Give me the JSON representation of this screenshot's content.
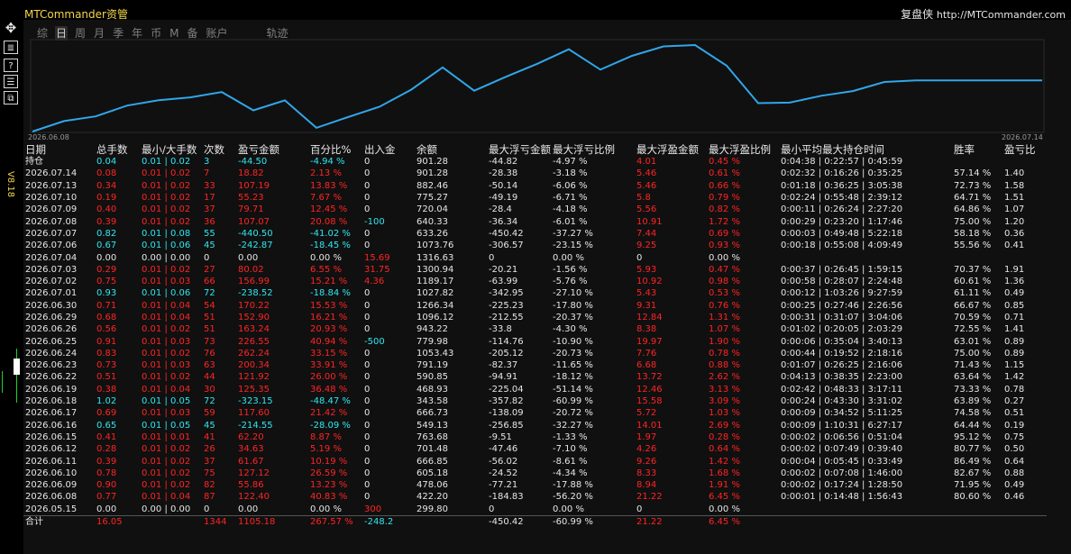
{
  "app": {
    "title": "MTCommander资管",
    "right_label": "复盘侠",
    "right_url": "http://MTCommander.com",
    "version": "V8.18"
  },
  "tabs": [
    "综",
    "日",
    "周",
    "月",
    "季",
    "年",
    "币",
    "M",
    "备",
    "账户",
    "轨迹"
  ],
  "active_tab": "日",
  "sidebar_buttons": [
    "move-icon",
    "list-icon",
    "help-icon",
    "settings-icon",
    "window-icon"
  ],
  "chart": {
    "start_date": "2026.06.08",
    "end_date": "2026.07.14",
    "line_color": "#31a6e8",
    "balance_series": [
      299.8,
      422.2,
      478.06,
      605.18,
      666.85,
      701.48,
      763.68,
      549.13,
      666.73,
      343.58,
      468.93,
      590.85,
      791.19,
      1053.43,
      779.98,
      943.22,
      1096.12,
      1266.34,
      1027.82,
      1189.17,
      1300.94,
      1316.63,
      1073.76,
      633.26,
      640.33,
      720.04,
      775.27,
      882.46,
      901.28,
      901.28,
      901.28,
      901.28,
      901.28
    ]
  },
  "table": {
    "headers": [
      "日期",
      "总手数",
      "最小/大手数",
      "次数",
      "盈亏金额",
      "百分比%",
      "出入金",
      "余额",
      "最大浮亏金额",
      "最大浮亏比例",
      "最大浮盈金额",
      "最大浮盈比例",
      "最小平均最大持仓时间",
      "胜率",
      "盈亏比"
    ],
    "rows": [
      {
        "date": "持仓",
        "lots": "0.04",
        "minmax": "0.01 | 0.02",
        "count": "3",
        "pl": "-44.50",
        "pct": "-4.94 %",
        "dep": "0",
        "bal": "901.28",
        "mdd": "-44.82",
        "mddp": "-4.97 %",
        "mfe": "4.01",
        "mfep": "0.45 %",
        "hold": "0:04:38 | 0:22:57 | 0:45:59",
        "win": "",
        "pf": ""
      },
      {
        "date": "2026.07.14",
        "lots": "0.08",
        "minmax": "0.01 | 0.02",
        "count": "7",
        "pl": "18.82",
        "pct": "2.13 %",
        "dep": "0",
        "bal": "901.28",
        "mdd": "-28.38",
        "mddp": "-3.18 %",
        "mfe": "5.46",
        "mfep": "0.61 %",
        "hold": "0:02:32 | 0:16:26 | 0:35:25",
        "win": "57.14 %",
        "pf": "1.40"
      },
      {
        "date": "2026.07.13",
        "lots": "0.34",
        "minmax": "0.01 | 0.02",
        "count": "33",
        "pl": "107.19",
        "pct": "13.83 %",
        "dep": "0",
        "bal": "882.46",
        "mdd": "-50.14",
        "mddp": "-6.06 %",
        "mfe": "5.46",
        "mfep": "0.66 %",
        "hold": "0:01:18 | 0:36:25 | 3:05:38",
        "win": "72.73 %",
        "pf": "1.58"
      },
      {
        "date": "2026.07.10",
        "lots": "0.19",
        "minmax": "0.01 | 0.02",
        "count": "17",
        "pl": "55.23",
        "pct": "7.67 %",
        "dep": "0",
        "bal": "775.27",
        "mdd": "-49.19",
        "mddp": "-6.71 %",
        "mfe": "5.8",
        "mfep": "0.79 %",
        "hold": "0:02:24 | 0:55:48 | 2:39:12",
        "win": "64.71 %",
        "pf": "1.51"
      },
      {
        "date": "2026.07.09",
        "lots": "0.40",
        "minmax": "0.01 | 0.02",
        "count": "37",
        "pl": "79.71",
        "pct": "12.45 %",
        "dep": "0",
        "bal": "720.04",
        "mdd": "-28.4",
        "mddp": "-4.18 %",
        "mfe": "5.56",
        "mfep": "0.82 %",
        "hold": "0:00:11 | 0:26:24 | 2:27:20",
        "win": "64.86 %",
        "pf": "1.07"
      },
      {
        "date": "2026.07.08",
        "lots": "0.39",
        "minmax": "0.01 | 0.02",
        "count": "36",
        "pl": "107.07",
        "pct": "20.08 %",
        "dep": "-100",
        "bal": "640.33",
        "mdd": "-36.34",
        "mddp": "-6.01 %",
        "mfe": "10.91",
        "mfep": "1.72 %",
        "hold": "0:00:29 | 0:23:20 | 1:17:46",
        "win": "75.00 %",
        "pf": "1.20"
      },
      {
        "date": "2026.07.07",
        "lots": "0.82",
        "minmax": "0.01 | 0.08",
        "count": "55",
        "pl": "-440.50",
        "pct": "-41.02 %",
        "dep": "0",
        "bal": "633.26",
        "mdd": "-450.42",
        "mddp": "-37.27 %",
        "mfe": "7.44",
        "mfep": "0.69 %",
        "hold": "0:00:03 | 0:49:48 | 5:22:18",
        "win": "58.18 %",
        "pf": "0.36"
      },
      {
        "date": "2026.07.06",
        "lots": "0.67",
        "minmax": "0.01 | 0.06",
        "count": "45",
        "pl": "-242.87",
        "pct": "-18.45 %",
        "dep": "0",
        "bal": "1073.76",
        "mdd": "-306.57",
        "mddp": "-23.15 %",
        "mfe": "9.25",
        "mfep": "0.93 %",
        "hold": "0:00:18 | 0:55:08 | 4:09:49",
        "win": "55.56 %",
        "pf": "0.41"
      },
      {
        "date": "2026.07.04",
        "lots": "0.00",
        "minmax": "0.00 | 0.00",
        "count": "0",
        "pl": "0.00",
        "pct": "0.00 %",
        "dep": "15.69",
        "bal": "1316.63",
        "mdd": "0",
        "mddp": "0.00 %",
        "mfe": "0",
        "mfep": "0.00 %",
        "hold": "",
        "win": "",
        "pf": ""
      },
      {
        "date": "2026.07.03",
        "lots": "0.29",
        "minmax": "0.01 | 0.02",
        "count": "27",
        "pl": "80.02",
        "pct": "6.55 %",
        "dep": "31.75",
        "bal": "1300.94",
        "mdd": "-20.21",
        "mddp": "-1.56 %",
        "mfe": "5.93",
        "mfep": "0.47 %",
        "hold": "0:00:37 | 0:26:45 | 1:59:15",
        "win": "70.37 %",
        "pf": "1.91"
      },
      {
        "date": "2026.07.02",
        "lots": "0.75",
        "minmax": "0.01 | 0.03",
        "count": "66",
        "pl": "156.99",
        "pct": "15.21 %",
        "dep": "4.36",
        "bal": "1189.17",
        "mdd": "-63.99",
        "mddp": "-5.76 %",
        "mfe": "10.92",
        "mfep": "0.98 %",
        "hold": "0:00:58 | 0:28:07 | 2:24:48",
        "win": "60.61 %",
        "pf": "1.36"
      },
      {
        "date": "2026.07.01",
        "lots": "0.93",
        "minmax": "0.01 | 0.06",
        "count": "72",
        "pl": "-238.52",
        "pct": "-18.84 %",
        "dep": "0",
        "bal": "1027.82",
        "mdd": "-342.95",
        "mddp": "-27.10 %",
        "mfe": "5.43",
        "mfep": "0.53 %",
        "hold": "0:00:12 | 1:03:26 | 9:27:59",
        "win": "61.11 %",
        "pf": "0.49"
      },
      {
        "date": "2026.06.30",
        "lots": "0.71",
        "minmax": "0.01 | 0.04",
        "count": "54",
        "pl": "170.22",
        "pct": "15.53 %",
        "dep": "0",
        "bal": "1266.34",
        "mdd": "-225.23",
        "mddp": "-17.80 %",
        "mfe": "9.31",
        "mfep": "0.76 %",
        "hold": "0:00:25 | 0:27:46 | 2:26:56",
        "win": "66.67 %",
        "pf": "0.85"
      },
      {
        "date": "2026.06.29",
        "lots": "0.68",
        "minmax": "0.01 | 0.04",
        "count": "51",
        "pl": "152.90",
        "pct": "16.21 %",
        "dep": "0",
        "bal": "1096.12",
        "mdd": "-212.55",
        "mddp": "-20.37 %",
        "mfe": "12.84",
        "mfep": "1.31 %",
        "hold": "0:00:31 | 0:31:07 | 3:04:06",
        "win": "70.59 %",
        "pf": "0.71"
      },
      {
        "date": "2026.06.26",
        "lots": "0.56",
        "minmax": "0.01 | 0.02",
        "count": "51",
        "pl": "163.24",
        "pct": "20.93 %",
        "dep": "0",
        "bal": "943.22",
        "mdd": "-33.8",
        "mddp": "-4.30 %",
        "mfe": "8.38",
        "mfep": "1.07 %",
        "hold": "0:01:02 | 0:20:05 | 2:03:29",
        "win": "72.55 %",
        "pf": "1.41"
      },
      {
        "date": "2026.06.25",
        "lots": "0.91",
        "minmax": "0.01 | 0.03",
        "count": "73",
        "pl": "226.55",
        "pct": "40.94 %",
        "dep": "-500",
        "bal": "779.98",
        "mdd": "-114.76",
        "mddp": "-10.90 %",
        "mfe": "19.97",
        "mfep": "1.90 %",
        "hold": "0:00:06 | 0:35:04 | 3:40:13",
        "win": "63.01 %",
        "pf": "0.89"
      },
      {
        "date": "2026.06.24",
        "lots": "0.83",
        "minmax": "0.01 | 0.02",
        "count": "76",
        "pl": "262.24",
        "pct": "33.15 %",
        "dep": "0",
        "bal": "1053.43",
        "mdd": "-205.12",
        "mddp": "-20.73 %",
        "mfe": "7.76",
        "mfep": "0.78 %",
        "hold": "0:00:44 | 0:19:52 | 2:18:16",
        "win": "75.00 %",
        "pf": "0.89"
      },
      {
        "date": "2026.06.23",
        "lots": "0.73",
        "minmax": "0.01 | 0.03",
        "count": "63",
        "pl": "200.34",
        "pct": "33.91 %",
        "dep": "0",
        "bal": "791.19",
        "mdd": "-82.37",
        "mddp": "-11.65 %",
        "mfe": "6.68",
        "mfep": "0.88 %",
        "hold": "0:01:07 | 0:26:25 | 2:16:06",
        "win": "71.43 %",
        "pf": "1.15"
      },
      {
        "date": "2026.06.22",
        "lots": "0.51",
        "minmax": "0.01 | 0.02",
        "count": "44",
        "pl": "121.92",
        "pct": "26.00 %",
        "dep": "0",
        "bal": "590.85",
        "mdd": "-94.91",
        "mddp": "-18.12 %",
        "mfe": "13.72",
        "mfep": "2.62 %",
        "hold": "0:04:13 | 0:38:35 | 2:23:00",
        "win": "63.64 %",
        "pf": "1.42"
      },
      {
        "date": "2026.06.19",
        "lots": "0.38",
        "minmax": "0.01 | 0.04",
        "count": "30",
        "pl": "125.35",
        "pct": "36.48 %",
        "dep": "0",
        "bal": "468.93",
        "mdd": "-225.04",
        "mddp": "-51.14 %",
        "mfe": "12.46",
        "mfep": "3.13 %",
        "hold": "0:02:42 | 0:48:33 | 3:17:11",
        "win": "73.33 %",
        "pf": "0.78"
      },
      {
        "date": "2026.06.18",
        "lots": "1.02",
        "minmax": "0.01 | 0.05",
        "count": "72",
        "pl": "-323.15",
        "pct": "-48.47 %",
        "dep": "0",
        "bal": "343.58",
        "mdd": "-357.82",
        "mddp": "-60.99 %",
        "mfe": "15.58",
        "mfep": "3.09 %",
        "hold": "0:00:24 | 0:43:30 | 3:31:02",
        "win": "63.89 %",
        "pf": "0.27"
      },
      {
        "date": "2026.06.17",
        "lots": "0.69",
        "minmax": "0.01 | 0.03",
        "count": "59",
        "pl": "117.60",
        "pct": "21.42 %",
        "dep": "0",
        "bal": "666.73",
        "mdd": "-138.09",
        "mddp": "-20.72 %",
        "mfe": "5.72",
        "mfep": "1.03 %",
        "hold": "0:00:09 | 0:34:52 | 5:11:25",
        "win": "74.58 %",
        "pf": "0.51"
      },
      {
        "date": "2026.06.16",
        "lots": "0.65",
        "minmax": "0.01 | 0.05",
        "count": "45",
        "pl": "-214.55",
        "pct": "-28.09 %",
        "dep": "0",
        "bal": "549.13",
        "mdd": "-256.85",
        "mddp": "-32.27 %",
        "mfe": "14.01",
        "mfep": "2.69 %",
        "hold": "0:00:09 | 1:10:31 | 6:27:17",
        "win": "64.44 %",
        "pf": "0.19"
      },
      {
        "date": "2026.06.15",
        "lots": "0.41",
        "minmax": "0.01 | 0.01",
        "count": "41",
        "pl": "62.20",
        "pct": "8.87 %",
        "dep": "0",
        "bal": "763.68",
        "mdd": "-9.51",
        "mddp": "-1.33 %",
        "mfe": "1.97",
        "mfep": "0.28 %",
        "hold": "0:00:02 | 0:06:56 | 0:51:04",
        "win": "95.12 %",
        "pf": "0.75"
      },
      {
        "date": "2026.06.12",
        "lots": "0.28",
        "minmax": "0.01 | 0.02",
        "count": "26",
        "pl": "34.63",
        "pct": "5.19 %",
        "dep": "0",
        "bal": "701.48",
        "mdd": "-47.46",
        "mddp": "-7.10 %",
        "mfe": "4.26",
        "mfep": "0.64 %",
        "hold": "0:00:02 | 0:07:49 | 0:39:40",
        "win": "80.77 %",
        "pf": "0.50"
      },
      {
        "date": "2026.06.11",
        "lots": "0.39",
        "minmax": "0.01 | 0.02",
        "count": "37",
        "pl": "61.67",
        "pct": "10.19 %",
        "dep": "0",
        "bal": "666.85",
        "mdd": "-56.02",
        "mddp": "-8.61 %",
        "mfe": "9.26",
        "mfep": "1.42 %",
        "hold": "0:00:04 | 0:05:45 | 0:33:49",
        "win": "86.49 %",
        "pf": "0.64"
      },
      {
        "date": "2026.06.10",
        "lots": "0.78",
        "minmax": "0.01 | 0.02",
        "count": "75",
        "pl": "127.12",
        "pct": "26.59 %",
        "dep": "0",
        "bal": "605.18",
        "mdd": "-24.52",
        "mddp": "-4.34 %",
        "mfe": "8.33",
        "mfep": "1.68 %",
        "hold": "0:00:02 | 0:07:08 | 1:46:00",
        "win": "82.67 %",
        "pf": "0.88"
      },
      {
        "date": "2026.06.09",
        "lots": "0.90",
        "minmax": "0.01 | 0.02",
        "count": "82",
        "pl": "55.86",
        "pct": "13.23 %",
        "dep": "0",
        "bal": "478.06",
        "mdd": "-77.21",
        "mddp": "-17.88 %",
        "mfe": "8.94",
        "mfep": "1.91 %",
        "hold": "0:00:02 | 0:17:24 | 1:28:50",
        "win": "71.95 %",
        "pf": "0.49"
      },
      {
        "date": "2026.06.08",
        "lots": "0.77",
        "minmax": "0.01 | 0.04",
        "count": "87",
        "pl": "122.40",
        "pct": "40.83 %",
        "dep": "0",
        "bal": "422.20",
        "mdd": "-184.83",
        "mddp": "-56.20 %",
        "mfe": "21.22",
        "mfep": "6.45 %",
        "hold": "0:00:01 | 0:14:48 | 1:56:43",
        "win": "80.60 %",
        "pf": "0.46"
      },
      {
        "date": "2026.05.15",
        "lots": "0.00",
        "minmax": "0.00 | 0.00",
        "count": "0",
        "pl": "0.00",
        "pct": "0.00 %",
        "dep": "300",
        "bal": "299.80",
        "mdd": "0",
        "mddp": "0.00 %",
        "mfe": "0",
        "mfep": "0.00 %",
        "hold": "",
        "win": "",
        "pf": ""
      }
    ],
    "total": {
      "date": "合计",
      "lots": "16.05",
      "minmax": "",
      "count": "1344",
      "pl": "1105.18",
      "pct": "267.57 %",
      "dep": "-248.2",
      "bal": "",
      "mdd": "-450.42",
      "mddp": "-60.99 %",
      "mfe": "21.22",
      "mfep": "6.45 %",
      "hold": "",
      "win": "",
      "pf": ""
    }
  },
  "colors": {
    "positive": "#ff2424",
    "negative": "#2fe7f0",
    "neutral": "#e6e6e6",
    "title": "#f2d64a"
  }
}
